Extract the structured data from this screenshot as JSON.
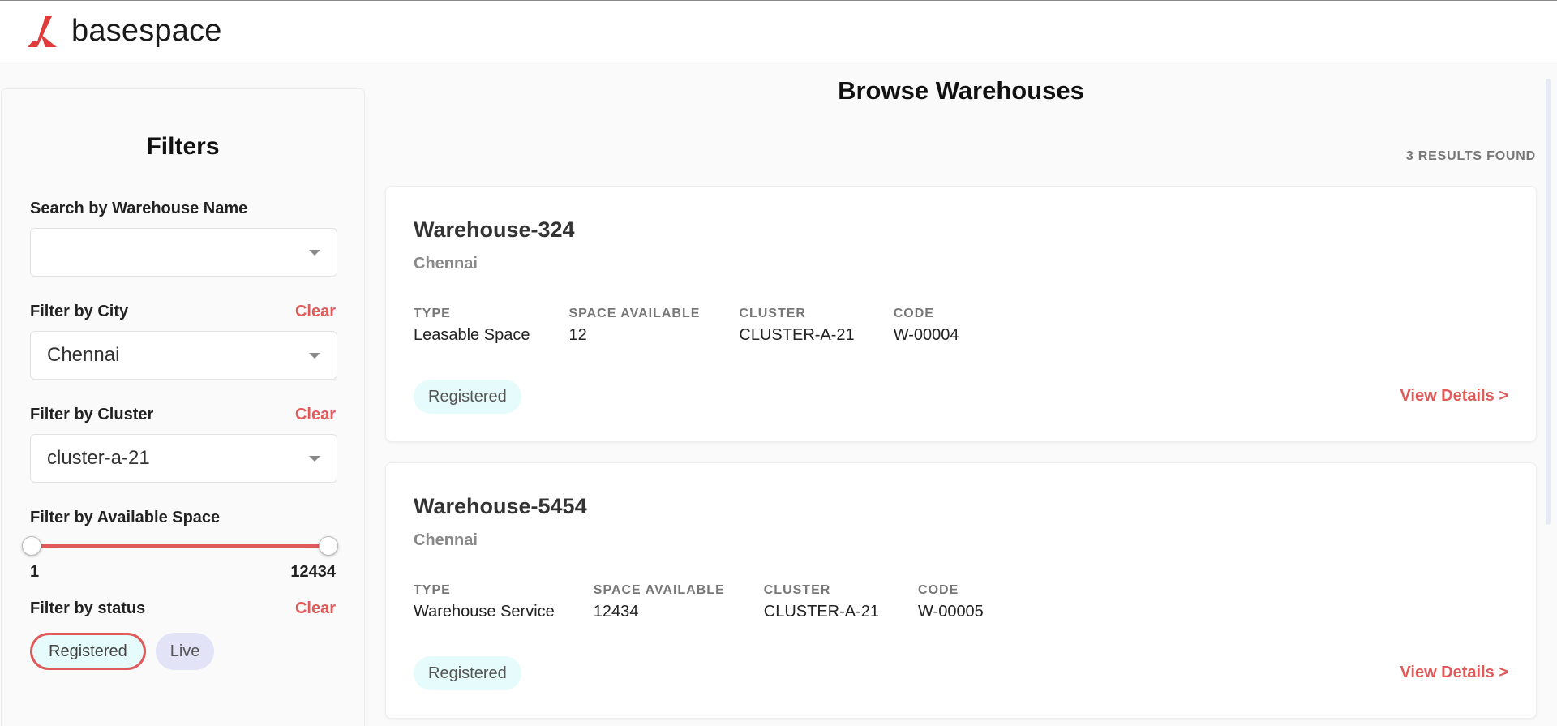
{
  "header": {
    "brand": "basespace"
  },
  "sidebar": {
    "title": "Filters",
    "search": {
      "label": "Search by Warehouse Name",
      "value": ""
    },
    "city": {
      "label": "Filter by City",
      "clear": "Clear",
      "value": "Chennai"
    },
    "cluster": {
      "label": "Filter by Cluster",
      "clear": "Clear",
      "value": "cluster-a-21"
    },
    "space": {
      "label": "Filter by Available Space",
      "min": "1",
      "max": "12434"
    },
    "status": {
      "label": "Filter by status",
      "clear": "Clear",
      "options": [
        "Registered",
        "Live"
      ],
      "selected": "Registered"
    }
  },
  "main": {
    "title": "Browse Warehouses",
    "results": "3 RESULTS FOUND",
    "cards": [
      {
        "name": "Warehouse-324",
        "city": "Chennai",
        "type_label": "TYPE",
        "type": "Leasable Space",
        "space_label": "SPACE AVAILABLE",
        "space": "12",
        "cluster_label": "CLUSTER",
        "cluster": "CLUSTER-A-21",
        "code_label": "CODE",
        "code": "W-00004",
        "status": "Registered",
        "link": "View Details >"
      },
      {
        "name": "Warehouse-5454",
        "city": "Chennai",
        "type_label": "TYPE",
        "type": "Warehouse Service",
        "space_label": "SPACE AVAILABLE",
        "space": "12434",
        "cluster_label": "CLUSTER",
        "cluster": "CLUSTER-A-21",
        "code_label": "CODE",
        "code": "W-00005",
        "status": "Registered",
        "link": "View Details >"
      }
    ]
  },
  "colors": {
    "accent": "#e05a5a",
    "chip_registered": "#e6fbfb",
    "chip_live": "#e3e3f8"
  }
}
